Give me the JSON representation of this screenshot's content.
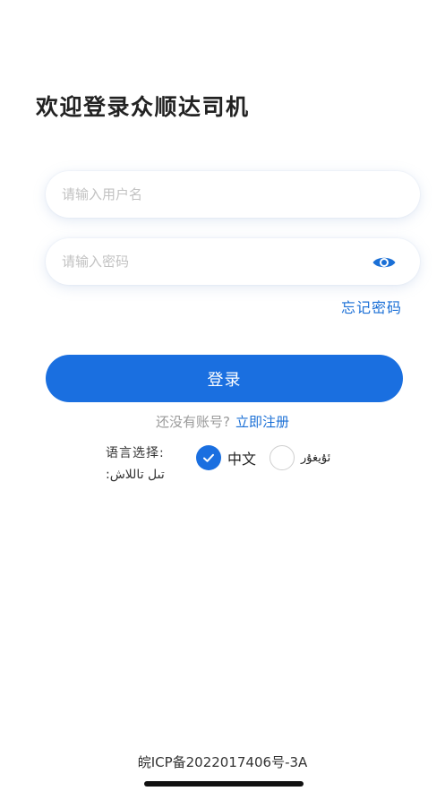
{
  "title": "欢迎登录众顺达司机",
  "form": {
    "username_placeholder": "请输入用户名",
    "username_value": "",
    "password_placeholder": "请输入密码",
    "password_value": "",
    "eye_icon": "eye-icon",
    "forgot_password_label": "忘记密码",
    "login_label": "登录"
  },
  "register": {
    "prompt": "还没有账号?",
    "link_label": "立即注册"
  },
  "language": {
    "label_zh": "语言选择:",
    "label_ug": "تىل تاللاش:",
    "options": [
      {
        "label": "中文",
        "selected": true
      },
      {
        "label": "ئۇيغۇر",
        "selected": false
      }
    ]
  },
  "footer": {
    "icp": "皖ICP备2022017406号-3A"
  },
  "colors": {
    "accent": "#1a6fe0",
    "link": "#1a6fd6",
    "placeholder": "#c2c2c2",
    "muted": "#9a9a9a"
  }
}
